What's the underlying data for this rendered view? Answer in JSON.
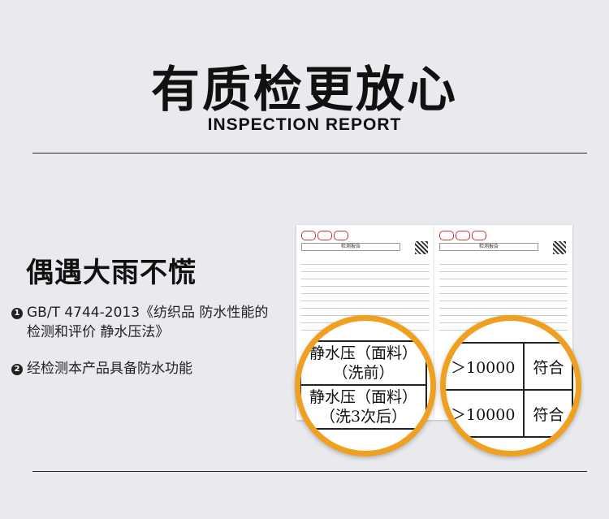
{
  "header": {
    "title": "有质检更放心",
    "subtitle": "INSPECTION REPORT"
  },
  "feature": {
    "heading": "偶遇大雨不慌",
    "points": [
      {
        "index": "1",
        "line1": "GB/T 4744-2013《纺织品 防水性能的",
        "line2": "检测和评价 静水压法》"
      },
      {
        "index": "2",
        "line1": "经检测本产品具备防水功能"
      }
    ]
  },
  "report": {
    "doc_header": "检测报告",
    "zoom_left": {
      "rows": [
        {
          "line1": "静水压（面料）",
          "line2": "（洗前）"
        },
        {
          "line1": "静水压（面料）",
          "line2": "（洗3次后）"
        }
      ]
    },
    "zoom_right": {
      "rows": [
        {
          "value": "＞10000",
          "result": "符合"
        },
        {
          "value": "＞10000",
          "result": "符合"
        }
      ]
    },
    "accent_color": "#f0a020"
  }
}
